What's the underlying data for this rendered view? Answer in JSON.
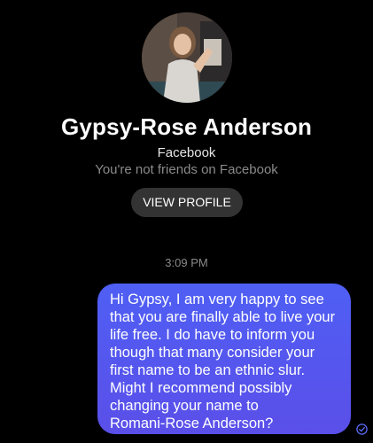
{
  "profile": {
    "name": "Gypsy-Rose Anderson",
    "platform": "Facebook",
    "friend_status": "You're not friends on Facebook",
    "view_profile_label": "VIEW PROFILE"
  },
  "conversation": {
    "timestamp": "3:09 PM",
    "message": "Hi Gypsy, I am very happy to see\nthat you are finally able to live your\nlife free. I do have to inform you\nthough that many consider your\nfirst name to be an ethnic slur.\nMight I recommend possibly\nchanging your name to\nRomani-Rose Anderson?"
  },
  "colors": {
    "bubble_top": "#4f5ff4",
    "bubble_bottom": "#5a4fe9",
    "button_bg": "#333333",
    "seen_check": "#5b6cf5"
  },
  "icons": {
    "seen": "check-circle-icon"
  }
}
